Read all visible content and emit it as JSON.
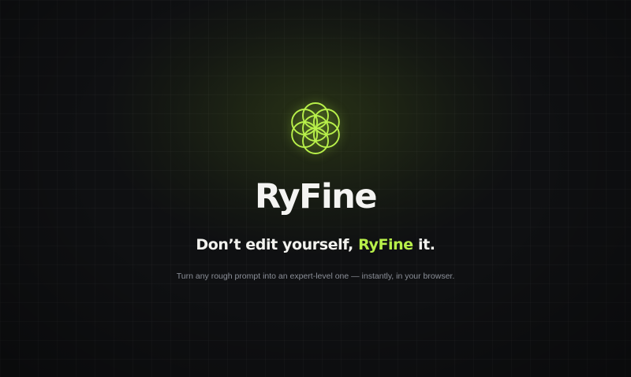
{
  "colors": {
    "background": "#0f1012",
    "accent": "#b8f04a",
    "heading": "#f4f4f2",
    "subtitle": "#8b8f98"
  },
  "logo": {
    "icon": "flower-of-life-icon"
  },
  "brand": {
    "name": "RyFine"
  },
  "tagline": {
    "prefix": "Don’t edit yourself, ",
    "highlight": "RyFine",
    "suffix": " it."
  },
  "subtitle": "Turn any rough prompt into an expert-level one — instantly, in your browser."
}
